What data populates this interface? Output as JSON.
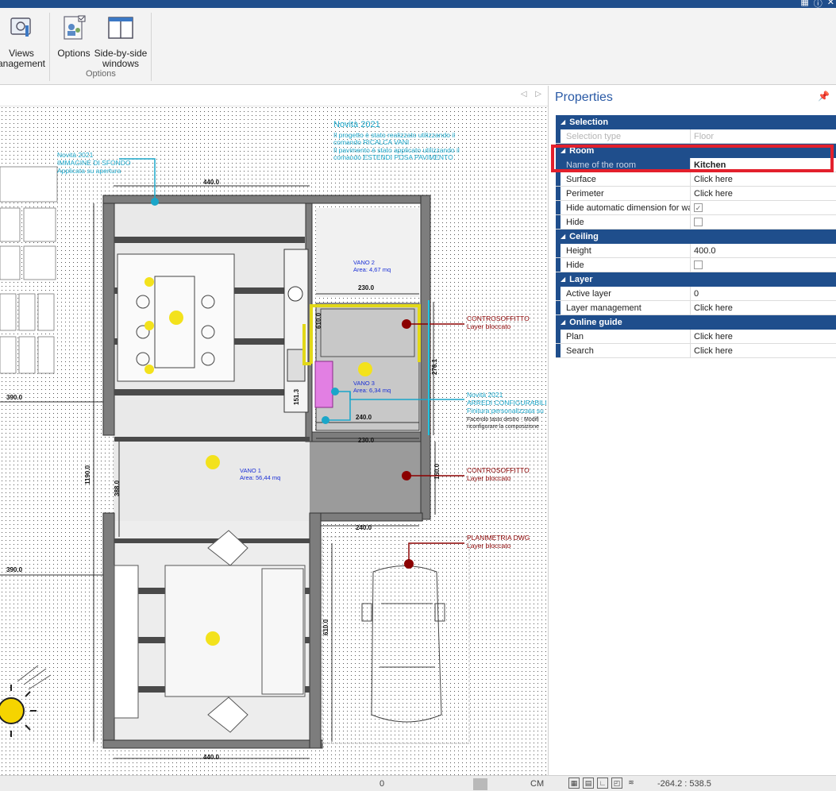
{
  "ribbon": {
    "views_label_1": "Views",
    "views_label_2": "anagement",
    "options_label": "Options",
    "sbs_label_1": "Side-by-side",
    "sbs_label_2": "windows",
    "group_label": "Options"
  },
  "drawing": {
    "note_top": [
      "Novità 2021",
      "Il progetto è stato realizzato utilizzando il",
      "comando RICALCA VANI",
      "Il pavimento è stato applicato utilizzando il",
      "comando ESTENDI POSA PAVIMENTO"
    ],
    "note_image": [
      "Novità 2021",
      "IMMAGINE DI SFONDO",
      "Applicata su apertura"
    ],
    "note_furniture": [
      "Novità 2021",
      "ARREDI CONFIGURABILI",
      "Finitura personalizzata su",
      "Facendo tasto destro - Modifi",
      "riconfigurare la composizione"
    ],
    "ceiling1": [
      "CONTROSOFFITTO",
      "Layer bloccato"
    ],
    "ceiling2": [
      "CONTROSOFFITTO",
      "Layer bloccato"
    ],
    "dwg": [
      "PLANIMETRIA DWG",
      "Layer bloccato"
    ],
    "vano2": [
      "VANO 2",
      "Area: 4,67 mq"
    ],
    "vano3": [
      "VANO 3",
      "Area: 6,34 mq"
    ],
    "vano1": [
      "VANO 1",
      "Area: 56,44 mq"
    ],
    "dims": {
      "top": "440.0",
      "bottom": "440.0",
      "k230a": "230.0",
      "k230b": "230.0",
      "k240a": "240.0",
      "k240b": "240.0",
      "k610a": "610.0",
      "k610b": "610.0",
      "k276": "276.1",
      "k151": "151.3",
      "k1190": "1190.0",
      "k390a": "390.0",
      "k390b": "390.0",
      "k160": "160.0",
      "k388": "388.0"
    }
  },
  "properties": {
    "title": "Properties",
    "pin_icon": "pin-icon",
    "categories": {
      "selection": "Selection",
      "room": "Room",
      "ceiling": "Ceiling",
      "layer": "Layer",
      "guide": "Online guide"
    },
    "rows": {
      "selection_type_k": "Selection type",
      "selection_type_v": "Floor",
      "room_name_k": "Name of the room",
      "room_name_v": "Kitchen",
      "surface_k": "Surface",
      "surface_v": "Click here",
      "perimeter_k": "Perimeter",
      "perimeter_v": "Click here",
      "hide_dim_k": "Hide automatic dimension for wal",
      "hide_room_k": "Hide",
      "height_k": "Height",
      "height_v": "400.0",
      "hide_ceiling_k": "Hide",
      "active_layer_k": "Active layer",
      "active_layer_v": "0",
      "layer_mgmt_k": "Layer management",
      "layer_mgmt_v": "Click here",
      "plan_k": "Plan",
      "plan_v": "Click here",
      "search_k": "Search",
      "search_v": "Click here"
    }
  },
  "status": {
    "left_value": "0",
    "units": "CM",
    "coords": "-264.2 : 538.5"
  },
  "colors": {
    "accent": "#1f4e8c",
    "highlight": "#e3202c",
    "note_cyan": "#1aa6c9",
    "note_red": "#8b0000",
    "note_blue": "#1a2fd6"
  }
}
